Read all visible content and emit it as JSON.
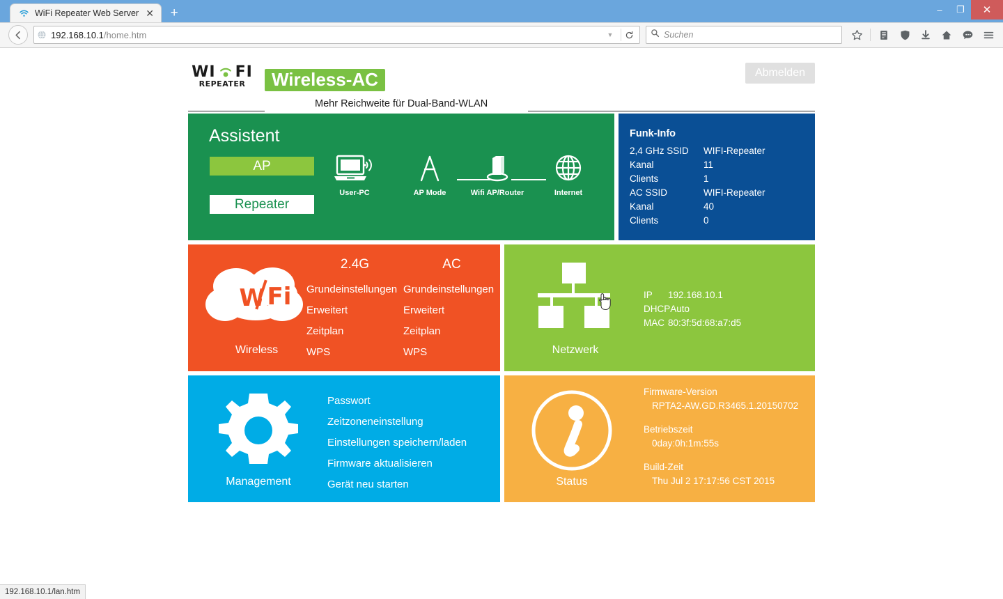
{
  "browser": {
    "tab": {
      "title": "WiFi Repeater Web Server",
      "favicon": "wifi-icon",
      "close": "✕"
    },
    "newtab_label": "+",
    "window_controls": {
      "minimize": "–",
      "maximize": "❐",
      "close": "✕"
    },
    "back_label": "←",
    "url": {
      "host": "192.168.10.1",
      "path": "/home.htm",
      "dropdown": "▼",
      "reload": "↻"
    },
    "search": {
      "placeholder": "Suchen",
      "icon": "search-icon"
    },
    "toolbar_icons": [
      "star-icon",
      "reader-list-icon",
      "shield-icon",
      "download-icon",
      "home-icon",
      "chat-icon",
      "hamburger-menu-icon"
    ],
    "statusbar_text": "192.168.10.1/lan.htm"
  },
  "header": {
    "logo_word_parts": [
      "WI",
      "FI"
    ],
    "logo_sub": "REPEATER",
    "brand_badge": "Wireless-AC",
    "tagline": "Mehr Reichweite für Dual-Band-WLAN",
    "logout_label": "Abmelden"
  },
  "assistent": {
    "title": "Assistent",
    "mode_ap": "AP",
    "mode_repeater": "Repeater",
    "diagram": {
      "nodes": [
        {
          "label": "User-PC",
          "icon": "laptop-wifi-icon"
        },
        {
          "label": "AP Mode",
          "icon": "antenna-icon"
        },
        {
          "label": "Wifi AP/Router",
          "icon": "router-icon"
        },
        {
          "label": "Internet",
          "icon": "globe-icon"
        }
      ]
    }
  },
  "funk_info": {
    "title": "Funk-Info",
    "rows": [
      {
        "key": "2,4 GHz SSID",
        "value": "WIFI-Repeater"
      },
      {
        "key": "Kanal",
        "value": "11"
      },
      {
        "key": "Clients",
        "value": "1"
      },
      {
        "key": "AC SSID",
        "value": "WIFI-Repeater"
      },
      {
        "key": "Kanal",
        "value": "40"
      },
      {
        "key": "Clients",
        "value": "0"
      }
    ]
  },
  "wireless": {
    "label": "Wireless",
    "icon": "wifi-cloud-icon",
    "columns": [
      {
        "head": "2.4G",
        "links": [
          "Grundeinstellungen",
          "Erweitert",
          "Zeitplan",
          "WPS"
        ]
      },
      {
        "head": "AC",
        "links": [
          "Grundeinstellungen",
          "Erweitert",
          "Zeitplan",
          "WPS"
        ]
      }
    ]
  },
  "netzwerk": {
    "label": "Netzwerk",
    "icon": "network-tree-icon",
    "rows": [
      {
        "key": "IP",
        "value": "192.168.10.1"
      },
      {
        "key": "DHCP",
        "value": "Auto"
      },
      {
        "key": "MAC",
        "value": "80:3f:5d:68:a7:d5"
      }
    ]
  },
  "management": {
    "label": "Management",
    "icon": "gear-icon",
    "links": [
      "Passwort",
      "Zeitzoneneinstellung",
      "Einstellungen speichern/laden",
      "Firmware aktualisieren",
      "Gerät neu starten"
    ]
  },
  "status": {
    "label": "Status",
    "icon": "info-icon",
    "groups": [
      {
        "key": "Firmware-Version",
        "value": "RPTA2-AW.GD.R3465.1.20150702"
      },
      {
        "key": "Betriebszeit",
        "value": "0day:0h:1m:55s"
      },
      {
        "key": "Build-Zeit",
        "value": "Thu Jul 2 17:17:56 CST 2015"
      }
    ]
  },
  "colors": {
    "green": "#1a9150",
    "dark_blue": "#0a4f95",
    "red": "#f05224",
    "light_green": "#8cc63e",
    "light_blue": "#00ace6",
    "orange": "#f7b043",
    "brand_green": "#7ac143"
  }
}
